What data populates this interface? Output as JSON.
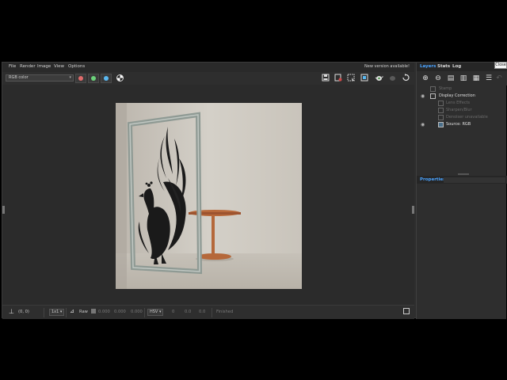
{
  "menubar": {
    "items": [
      "File",
      "Render",
      "Image",
      "View",
      "Options"
    ],
    "notice": "New version available!"
  },
  "toolbar": {
    "channel": "RGB color",
    "channel_buttons": [
      {
        "icon": "red-dot",
        "color": "#e06b6b"
      },
      {
        "icon": "green-dot",
        "color": "#6bd17a"
      },
      {
        "icon": "blue-dot",
        "color": "#5ab8f0"
      }
    ],
    "right_icons": [
      "save-icon",
      "export-icon",
      "region-icon",
      "fit-icon",
      "refresh-icon",
      "undo-icon",
      "redo-icon",
      "restart-icon"
    ]
  },
  "statusbar": {
    "coords": "(0, 0)",
    "zoom": "1x1",
    "raw_label": "Raw",
    "raw_values": [
      "0.000",
      "0.000",
      "0.000"
    ],
    "color_mode": "HSV",
    "hsv_values": [
      "0",
      "0.0",
      "0.0"
    ],
    "status": "Finished"
  },
  "right_panel": {
    "tabs": [
      "Layers",
      "Stats",
      "Log"
    ],
    "layers": [
      {
        "label": "Stamp",
        "enabled": false,
        "eye": false,
        "indent": 1
      },
      {
        "label": "Display Correction",
        "enabled": true,
        "eye": true,
        "indent": 1
      },
      {
        "label": "Lens Effects",
        "enabled": false,
        "eye": false,
        "indent": 2
      },
      {
        "label": "Sharpen/Blur",
        "enabled": false,
        "eye": false,
        "indent": 2
      },
      {
        "label": "Denoiser unavailable",
        "enabled": false,
        "eye": false,
        "indent": 2
      },
      {
        "label": "Source: RGB",
        "enabled": true,
        "eye": true,
        "indent": 1
      }
    ],
    "properties_label": "Properties"
  },
  "close_tooltip": "Close",
  "colors": {
    "accent": "#4aa3ff",
    "background": "#2e2e2e"
  }
}
